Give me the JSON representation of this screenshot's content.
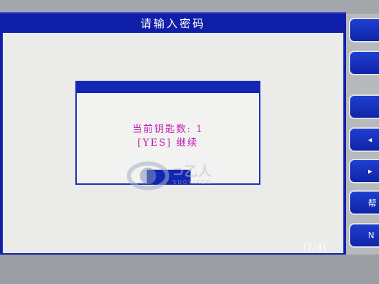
{
  "window": {
    "title": "请输入密码"
  },
  "dialog": {
    "line1": "当前钥匙数: 1",
    "line2": "[YES] 继续",
    "yes_button": "YES"
  },
  "footer": {
    "page_indicator": "[3/4]"
  },
  "side_buttons": [
    {
      "label": ""
    },
    {
      "label": ""
    },
    {
      "label": ""
    },
    {
      "label": "",
      "icon": "chevron-left-icon"
    },
    {
      "label": "",
      "icon": "chevron-right-icon"
    },
    {
      "label": "帮"
    },
    {
      "label": "N"
    }
  ],
  "watermark": {
    "text": "SUOYIREN"
  },
  "colors": {
    "screen_blue": "#0f1fa8",
    "dialog_text": "#c41db7",
    "workspace": "#ebebea"
  }
}
